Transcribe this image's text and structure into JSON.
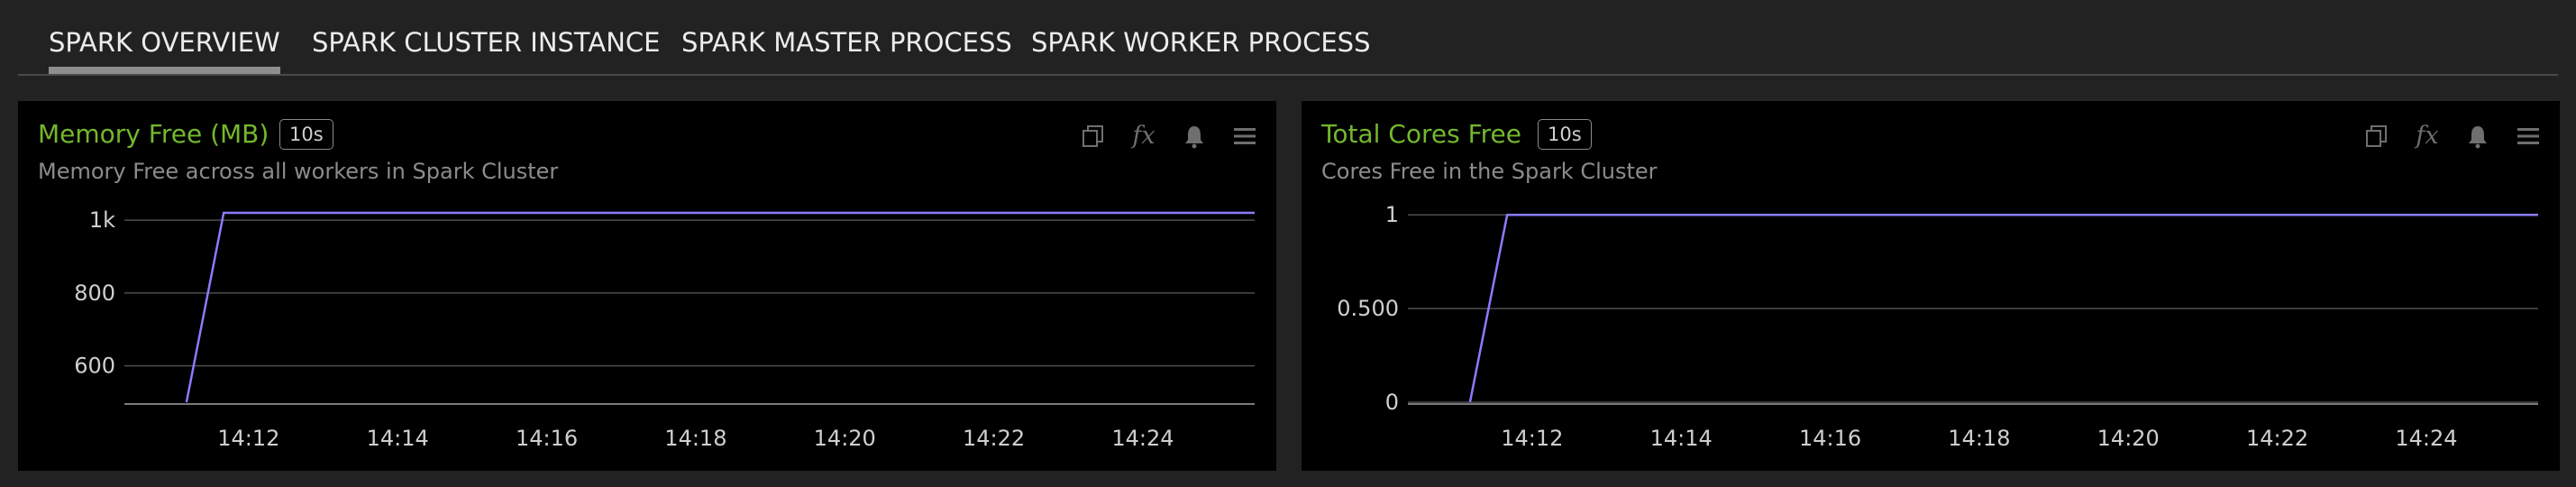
{
  "tabs": [
    {
      "label": "SPARK OVERVIEW",
      "active": true
    },
    {
      "label": "SPARK CLUSTER INSTANCE",
      "active": false
    },
    {
      "label": "SPARK MASTER PROCESS",
      "active": false
    },
    {
      "label": "SPARK WORKER PROCESS",
      "active": false
    }
  ],
  "panels": [
    {
      "title": "Memory Free (MB)",
      "badge": "10s",
      "subtitle": "Memory Free across all workers in Spark Cluster"
    },
    {
      "title": "Total Cores Free",
      "badge": "10s",
      "subtitle": "Cores Free in the Spark Cluster"
    }
  ],
  "icons": [
    "copy-icon",
    "function-icon",
    "bell-icon",
    "menu-icon"
  ],
  "colors": {
    "series": "#8a7cff",
    "title": "#74b82c",
    "grid": "#4e4e4e"
  },
  "chart_data": [
    {
      "type": "line",
      "title": "Memory Free (MB)",
      "xlabel": "",
      "ylabel": "",
      "x": [
        "14:11:10",
        "14:11:40",
        "14:25:30"
      ],
      "series": [
        {
          "values": [
            500,
            1020,
            1020
          ]
        }
      ],
      "ylim": [
        500,
        1030
      ],
      "xlim": [
        "14:10:20",
        "14:25:30"
      ],
      "yticks": [
        {
          "v": 600,
          "label": "600"
        },
        {
          "v": 800,
          "label": "800"
        },
        {
          "v": 1000,
          "label": "1k"
        }
      ],
      "xticks": [
        "14:12",
        "14:14",
        "14:16",
        "14:18",
        "14:20",
        "14:22",
        "14:24"
      ],
      "grid": true
    },
    {
      "type": "line",
      "title": "Total Cores Free",
      "xlabel": "",
      "ylabel": "",
      "x": [
        "14:11:10",
        "14:11:40",
        "14:25:30"
      ],
      "series": [
        {
          "values": [
            0,
            1,
            1
          ]
        }
      ],
      "ylim": [
        0,
        1.03
      ],
      "xlim": [
        "14:10:20",
        "14:25:30"
      ],
      "yticks": [
        {
          "v": 0,
          "label": "0"
        },
        {
          "v": 0.5,
          "label": "0.500"
        },
        {
          "v": 1,
          "label": "1"
        }
      ],
      "xticks": [
        "14:12",
        "14:14",
        "14:16",
        "14:18",
        "14:20",
        "14:22",
        "14:24"
      ],
      "grid": true
    }
  ]
}
